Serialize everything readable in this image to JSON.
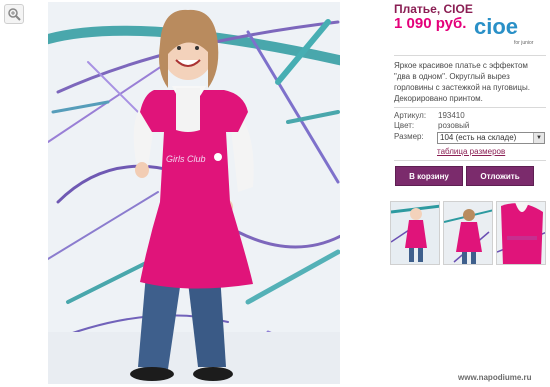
{
  "product": {
    "title": "Платье, CIOE",
    "price": "1 090 руб.",
    "description": "Яркое красивое платье с эффектом \"два в одном\". Округлый вырез горловины с застежкой на пуговицы. Декорировано принтом."
  },
  "brand": {
    "name": "cioe",
    "tagline": "for junior"
  },
  "specs": [
    {
      "label": "Артикул:",
      "value": "193410"
    },
    {
      "label": "Цвет:",
      "value": "розовый"
    },
    {
      "label": "Размер:",
      "value": ""
    }
  ],
  "size_select": {
    "selected": "104 (есть на складе)"
  },
  "links": {
    "size_table": "таблица размеров"
  },
  "buttons": {
    "add_to_cart": "В корзину",
    "defer": "Отложить"
  },
  "print_text": "Girls Club",
  "watermark": "www.napodiume.ru",
  "colors": {
    "accent": "#e4007a",
    "button": "#7b2b6c",
    "title": "#8a1e53",
    "dress": "#e0147a"
  },
  "icons": {
    "zoom": "magnifier-zoom-icon"
  }
}
